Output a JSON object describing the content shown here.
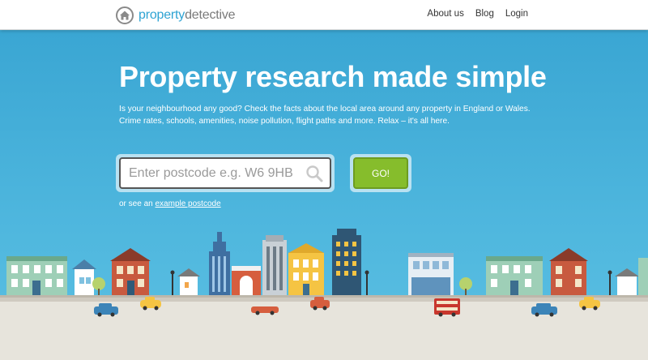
{
  "header": {
    "logo_part1": "property",
    "logo_part2": "detective",
    "logo_icon": "house-icon",
    "nav": [
      {
        "label": "About us"
      },
      {
        "label": "Blog"
      },
      {
        "label": "Login"
      }
    ]
  },
  "hero": {
    "headline": "Property research made simple",
    "subtext": "Is your neighbourhood any good? Check the facts about the local area around any property in England or Wales. Crime rates, schools, amenities, noise pollution, flight paths and more. Relax – it's all here.",
    "search_placeholder": "Enter postcode e.g. W6 9HB",
    "search_value": "",
    "search_icon": "search-icon",
    "go_label": "GO!",
    "example_prefix": "or see an",
    "example_link": "example postcode"
  },
  "colors": {
    "sky": "#45b0d9",
    "accent_blue": "#2ea3d3",
    "go_green": "#86bd2c",
    "road": "#e7e4dc"
  }
}
